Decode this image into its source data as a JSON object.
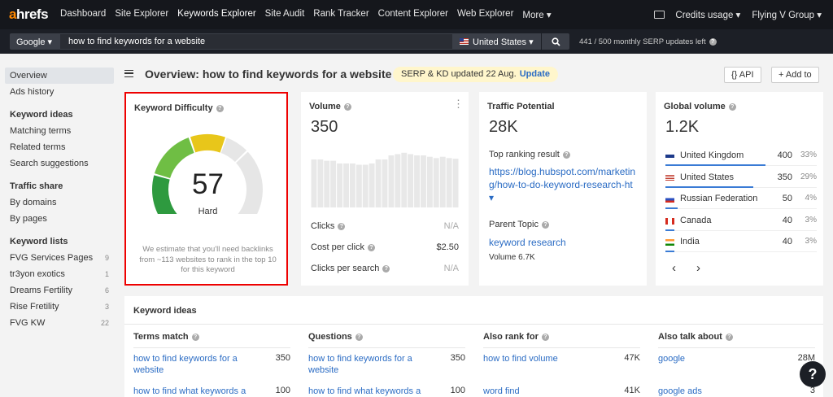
{
  "nav": {
    "logo_a": "a",
    "logo_rest": "hrefs",
    "items": [
      "Dashboard",
      "Site Explorer",
      "Keywords Explorer",
      "Site Audit",
      "Rank Tracker",
      "Content Explorer",
      "Web Explorer",
      "More ▾"
    ],
    "credits": "Credits usage ▾",
    "account": "Flying V Group ▾"
  },
  "search": {
    "engine": "Google ▾",
    "query": "how to find keywords for a website",
    "country": "United States ▾",
    "quota": "441 / 500 monthly SERP updates left"
  },
  "sidebar": {
    "items": [
      {
        "label": "Overview"
      },
      {
        "label": "Ads history"
      }
    ],
    "ideas_head": "Keyword ideas",
    "ideas": [
      "Matching terms",
      "Related terms",
      "Search suggestions"
    ],
    "traffic_head": "Traffic share",
    "traffic": [
      "By domains",
      "By pages"
    ],
    "lists_head": "Keyword lists",
    "lists": [
      {
        "label": "FVG Services Pages",
        "count": "9"
      },
      {
        "label": "tr3yon exotics",
        "count": "1"
      },
      {
        "label": "Dreams Fertility",
        "count": "6"
      },
      {
        "label": "Rise Fretility",
        "count": "3"
      },
      {
        "label": "FVG KW",
        "count": "22"
      }
    ]
  },
  "header": {
    "title": "Overview: how to find keywords for a website",
    "update_text": "SERP & KD updated 22 Aug.",
    "update_link": "Update",
    "api_label": "{} API",
    "add_label": "+ Add to"
  },
  "kd": {
    "title": "Keyword Difficulty",
    "value": "57",
    "fraction": 0.57,
    "label": "Hard",
    "note": "We estimate that you'll need backlinks from ~113 websites to rank in the top 10 for this keyword"
  },
  "volume": {
    "title": "Volume",
    "value": "350",
    "bars": [
      0.72,
      0.72,
      0.7,
      0.7,
      0.66,
      0.66,
      0.66,
      0.64,
      0.64,
      0.66,
      0.72,
      0.72,
      0.78,
      0.8,
      0.82,
      0.8,
      0.78,
      0.78,
      0.76,
      0.74,
      0.76,
      0.74,
      0.73
    ],
    "clicks_label": "Clicks",
    "clicks_value": "N/A",
    "cpc_label": "Cost per click",
    "cpc_value": "$2.50",
    "cps_label": "Clicks per search",
    "cps_value": "N/A"
  },
  "traffic": {
    "title": "Traffic Potential",
    "value": "28K",
    "top_label": "Top ranking result",
    "top_url": "https://blog.hubspot.com/marketing/how-to-do-keyword-research-ht ▾",
    "parent_label": "Parent Topic",
    "parent_link": "keyword research",
    "parent_volume": "Volume 6.7K"
  },
  "global": {
    "title": "Global volume",
    "value": "1.2K",
    "countries": [
      {
        "name": "United Kingdom",
        "value": "400",
        "pct": "33%",
        "share": 0.33,
        "flag": "uk"
      },
      {
        "name": "United States",
        "value": "350",
        "pct": "29%",
        "share": 0.29,
        "flag": "us"
      },
      {
        "name": "Russian Federation",
        "value": "50",
        "pct": "4%",
        "share": 0.04,
        "flag": "ru"
      },
      {
        "name": "Canada",
        "value": "40",
        "pct": "3%",
        "share": 0.03,
        "flag": "ca"
      },
      {
        "name": "India",
        "value": "40",
        "pct": "3%",
        "share": 0.03,
        "flag": "in"
      }
    ]
  },
  "ideas": {
    "title": "Keyword ideas",
    "columns": [
      {
        "head": "Terms match",
        "rows": [
          {
            "kw": "how to find keywords for a website",
            "n": "350"
          },
          {
            "kw": "how to find what keywords a",
            "n": "100"
          }
        ]
      },
      {
        "head": "Questions",
        "rows": [
          {
            "kw": "how to find keywords for a website",
            "n": "350"
          },
          {
            "kw": "how to find what keywords a",
            "n": "100"
          }
        ]
      },
      {
        "head": "Also rank for",
        "rows": [
          {
            "kw": "how to find volume",
            "n": "47K"
          },
          {
            "kw": "word find",
            "n": "41K"
          }
        ]
      },
      {
        "head": "Also talk about",
        "rows": [
          {
            "kw": "google",
            "n": "28M"
          },
          {
            "kw": "google ads",
            "n": "3"
          }
        ]
      }
    ]
  },
  "help": "?"
}
